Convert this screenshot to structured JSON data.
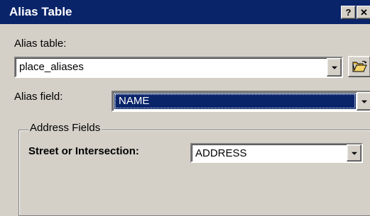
{
  "window": {
    "title": "Alias Table",
    "help_glyph": "?",
    "close_glyph": "✕"
  },
  "alias_table": {
    "label": "Alias table:",
    "value": "place_aliases"
  },
  "alias_field": {
    "label": "Alias field:",
    "value": "NAME"
  },
  "address_fields": {
    "legend": "Address Fields",
    "street_label": "Street or Intersection:",
    "street_value": "ADDRESS"
  },
  "colors": {
    "titlebar": "#0a246a",
    "face": "#d4d0c8",
    "selection": "#0a246a"
  },
  "icons": [
    "help-icon",
    "close-icon",
    "dropdown-arrow-icon",
    "open-folder-icon"
  ]
}
